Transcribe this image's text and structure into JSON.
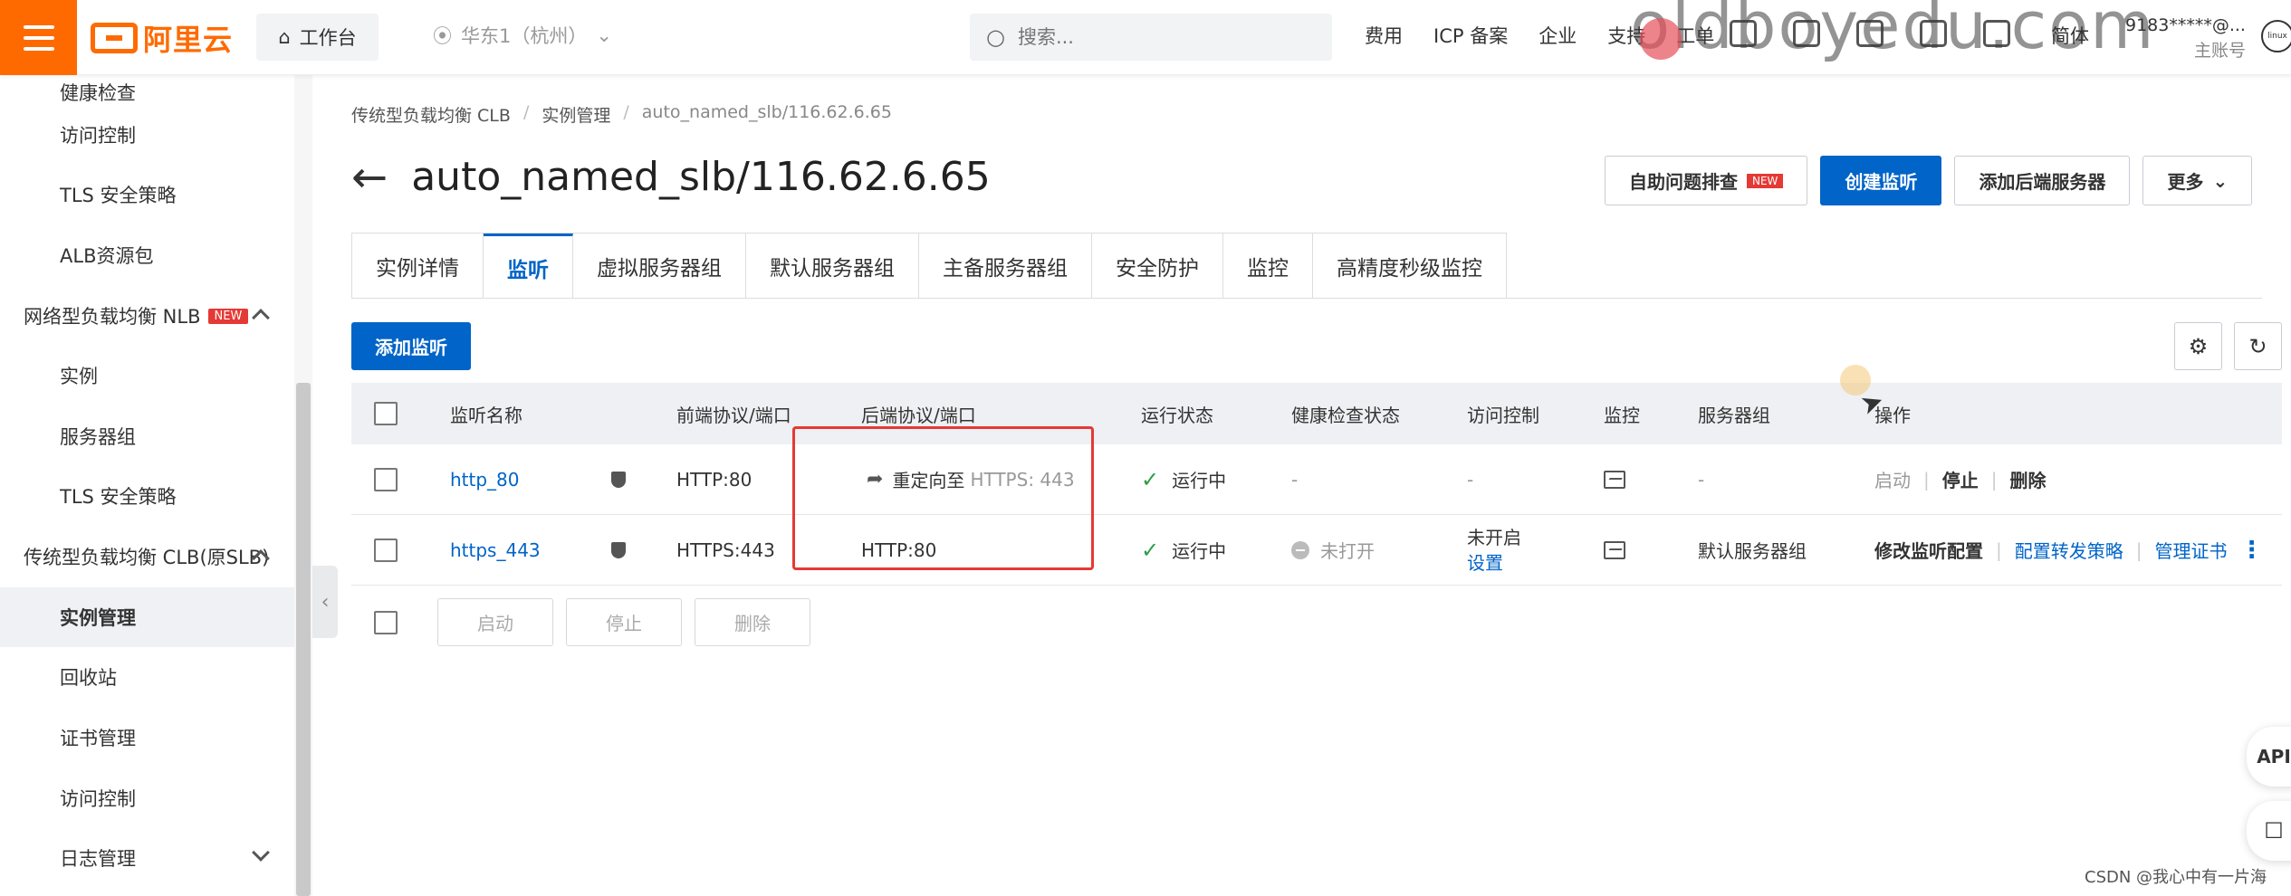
{
  "topbar": {
    "logo_text": "阿里云",
    "workbench": "工作台",
    "region": "华东1（杭州）",
    "search_placeholder": "搜索...",
    "nav": [
      "费用",
      "ICP 备案",
      "企业",
      "支持",
      "工单"
    ],
    "watermark": "oldboyedu.com",
    "lang": "简体",
    "account": "9183*****@...",
    "account_role": "主账号"
  },
  "sidebar": {
    "items": [
      {
        "label": "健康检查",
        "type": "sub"
      },
      {
        "label": "访问控制",
        "type": "sub"
      },
      {
        "label": "TLS 安全策略",
        "type": "sub"
      },
      {
        "label": "ALB资源包",
        "type": "sub"
      },
      {
        "label": "网络型负载均衡 NLB",
        "type": "group",
        "badge": "NEW"
      },
      {
        "label": "实例",
        "type": "sub"
      },
      {
        "label": "服务器组",
        "type": "sub"
      },
      {
        "label": "TLS 安全策略",
        "type": "sub"
      },
      {
        "label": "传统型负载均衡 CLB(原SLB)",
        "type": "group"
      },
      {
        "label": "实例管理",
        "type": "sub",
        "active": true
      },
      {
        "label": "回收站",
        "type": "sub"
      },
      {
        "label": "证书管理",
        "type": "sub"
      },
      {
        "label": "访问控制",
        "type": "sub"
      },
      {
        "label": "日志管理",
        "type": "sub"
      }
    ]
  },
  "breadcrumb": [
    "传统型负载均衡 CLB",
    "实例管理",
    "auto_named_slb/116.62.6.65"
  ],
  "page": {
    "title": "auto_named_slb/116.62.6.65",
    "actions": {
      "troubleshoot": "自助问题排查",
      "troubleshoot_badge": "NEW",
      "create_listener": "创建监听",
      "add_backend": "添加后端服务器",
      "more": "更多"
    }
  },
  "tabs": [
    "实例详情",
    "监听",
    "虚拟服务器组",
    "默认服务器组",
    "主备服务器组",
    "安全防护",
    "监控",
    "高精度秒级监控"
  ],
  "toolbar": {
    "add_listener": "添加监听"
  },
  "table": {
    "headers": {
      "name": "监听名称",
      "frontend": "前端协议/端口",
      "backend": "后端协议/端口",
      "status": "运行状态",
      "health": "健康检查状态",
      "acl": "访问控制",
      "monitor": "监控",
      "server_group": "服务器组",
      "ops": "操作"
    },
    "rows": [
      {
        "name": "http_80",
        "frontend": "HTTP:80",
        "backend_prefix": "重定向至",
        "backend": "HTTPS: 443",
        "status": "运行中",
        "health": "-",
        "acl": "-",
        "acl_link": "",
        "server_group": "-",
        "ops": [
          "启动",
          "停止",
          "删除"
        ]
      },
      {
        "name": "https_443",
        "frontend": "HTTPS:443",
        "backend_prefix": "",
        "backend": "HTTP:80",
        "status": "运行中",
        "health": "未打开",
        "acl": "未开启",
        "acl_link": "设置",
        "server_group": "默认服务器组",
        "ops": [
          "修改监听配置",
          "配置转发策略",
          "管理证书"
        ]
      }
    ]
  },
  "bulk": {
    "start": "启动",
    "stop": "停止",
    "delete": "删除"
  },
  "floats": {
    "api": "API"
  },
  "credit": "CSDN @我心中有一片海"
}
